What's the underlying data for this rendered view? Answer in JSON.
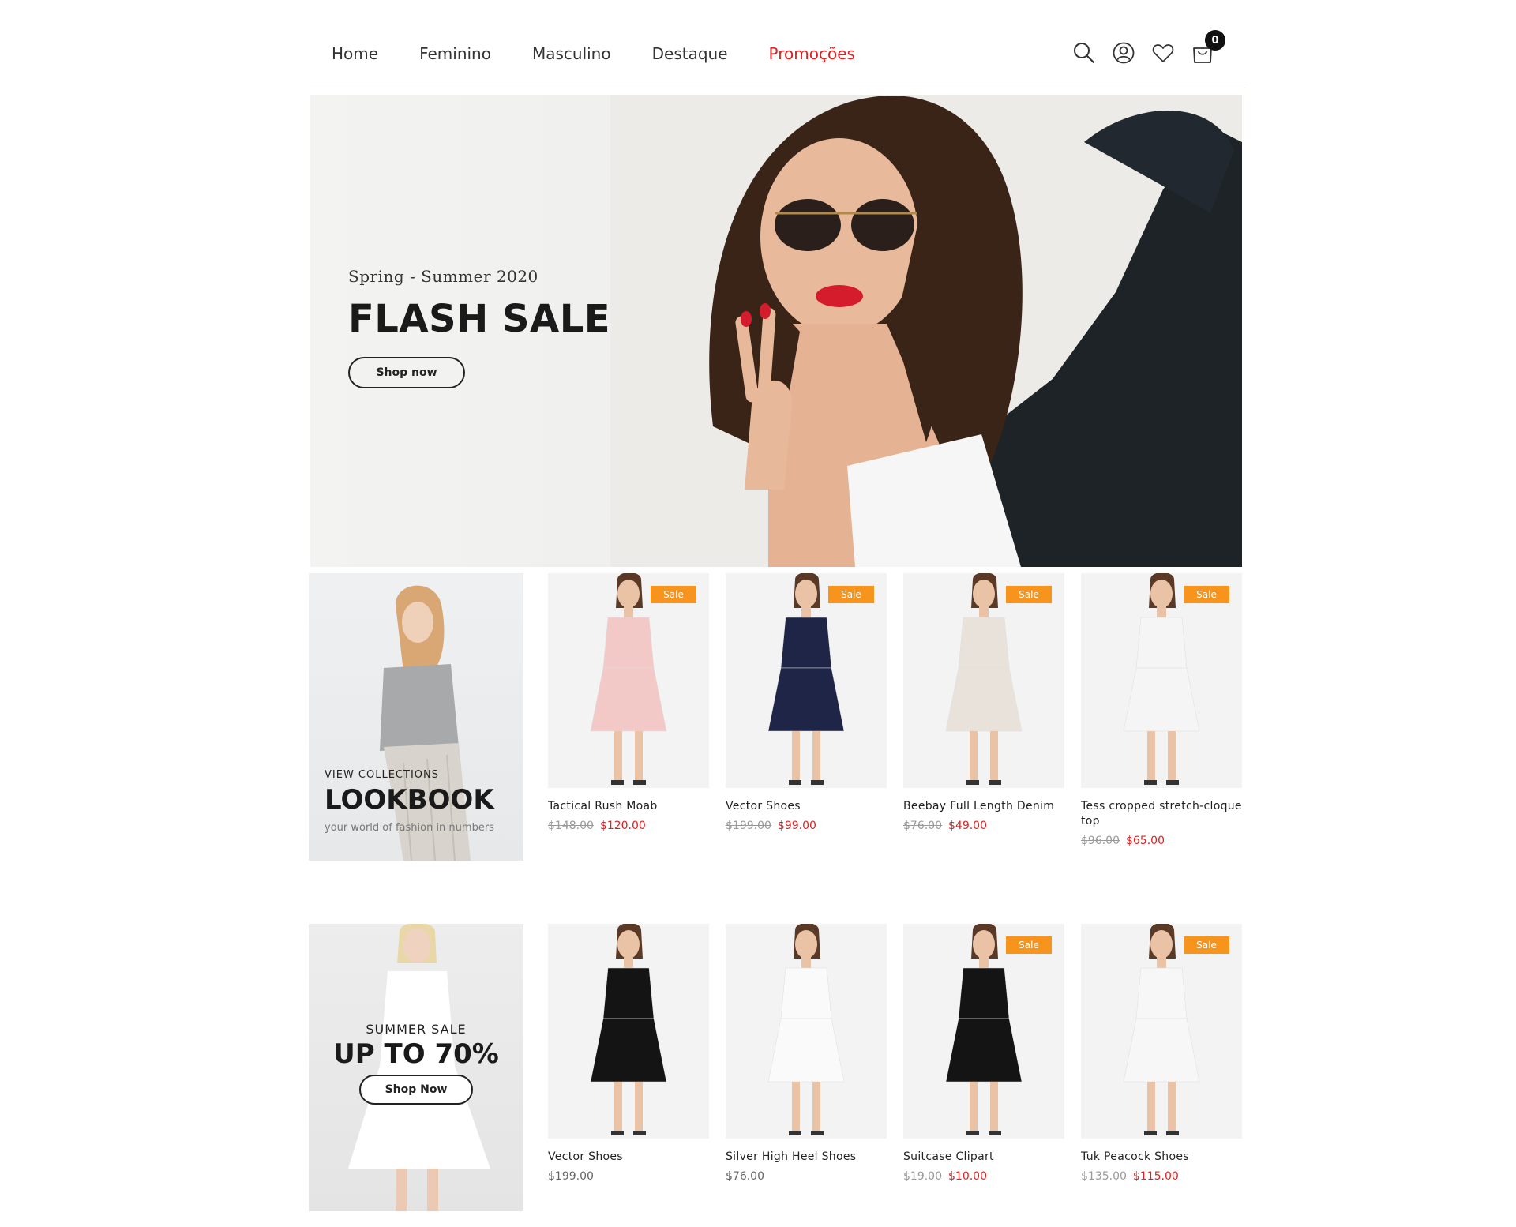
{
  "nav": {
    "items": [
      {
        "label": "Home"
      },
      {
        "label": "Feminino"
      },
      {
        "label": "Masculino"
      },
      {
        "label": "Destaque"
      },
      {
        "label": "Promoções",
        "color": "#e02020"
      }
    ],
    "cart_count": "0"
  },
  "hero": {
    "subtitle": "Spring - Summer 2020",
    "title": "FLASH SALE",
    "button": "Shop now"
  },
  "lookbook": {
    "eyebrow": "VIEW COLLECTIONS",
    "title": "LOOKBOOK",
    "tagline": "your world of fashion in numbers"
  },
  "summer": {
    "eyebrow": "SUMMER SALE",
    "title": "UP TO 70%",
    "button": "Shop Now"
  },
  "sale_badge": "Sale",
  "products": [
    {
      "name": "Tactical Rush Moab",
      "old_price": "$148.00",
      "price": "$120.00",
      "sale": true,
      "dress_color": "#f2c9c6"
    },
    {
      "name": "Vector Shoes",
      "old_price": "$199.00",
      "price": "$99.00",
      "sale": true,
      "dress_color": "#1f2547"
    },
    {
      "name": "Beebay Full Length Denim",
      "old_price": "$76.00",
      "price": "$49.00",
      "sale": true,
      "dress_color": "#e8e2da"
    },
    {
      "name": "Tess cropped stretch-cloque top",
      "old_price": "$96.00",
      "price": "$65.00",
      "sale": true,
      "dress_color": "#f5f5f5"
    },
    {
      "name": "Vector Shoes",
      "old_price": "",
      "price": "$199.00",
      "sale": false,
      "dress_color": "#141414"
    },
    {
      "name": "Silver High Heel Shoes",
      "old_price": "",
      "price": "$76.00",
      "sale": false,
      "dress_color": "#fafafa"
    },
    {
      "name": "Suitcase Clipart",
      "old_price": "$19.00",
      "price": "$10.00",
      "sale": true,
      "dress_color": "#141414"
    },
    {
      "name": "Tuk Peacock Shoes",
      "old_price": "$135.00",
      "price": "$115.00",
      "sale": true,
      "dress_color": "#f7f7f7"
    }
  ],
  "colors": {
    "accent_red": "#e02020",
    "sale_orange": "#f7941d"
  }
}
